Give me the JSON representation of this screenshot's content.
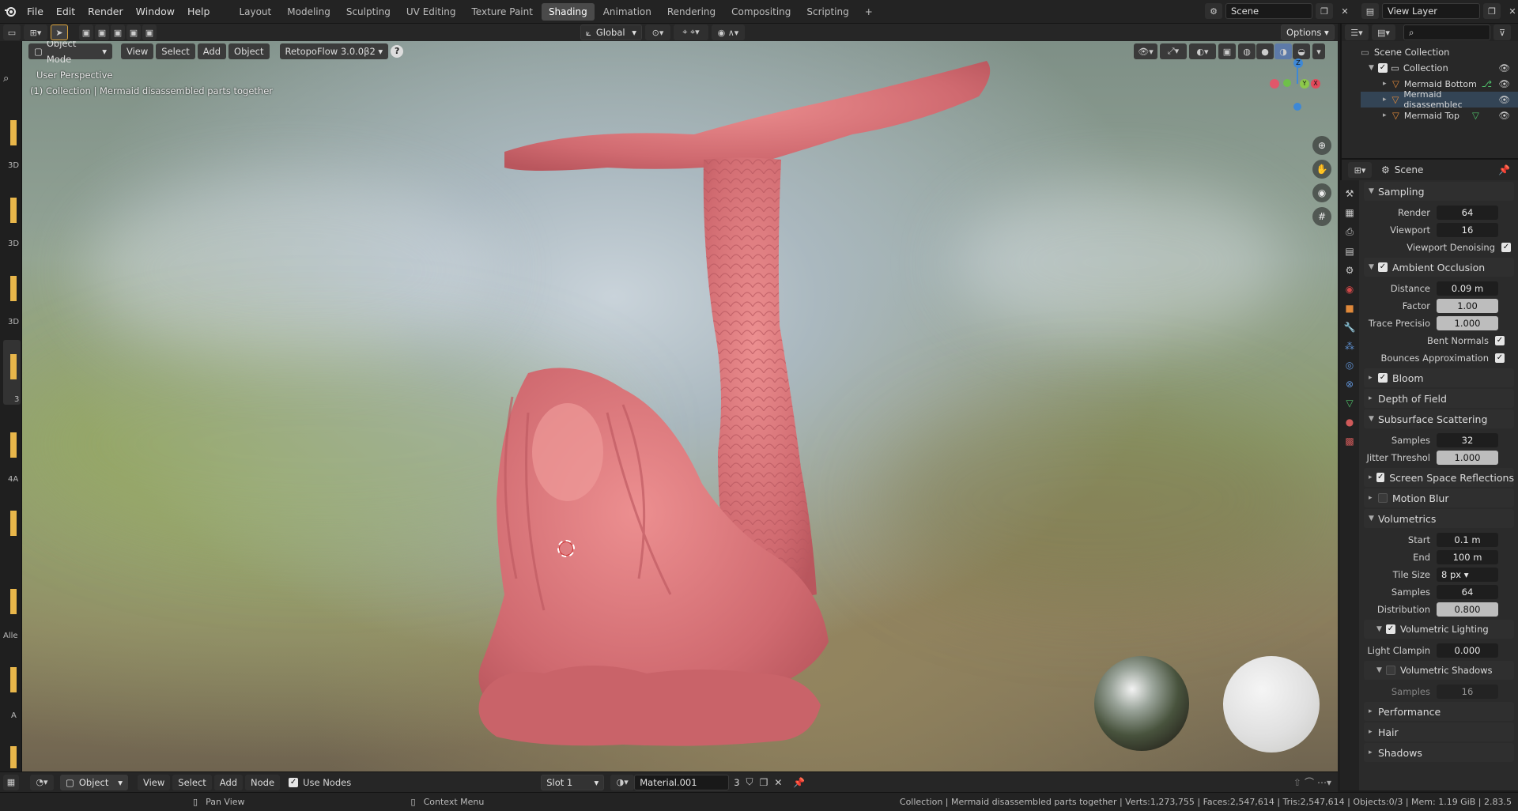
{
  "menubar": {
    "items": [
      "File",
      "Edit",
      "Render",
      "Window",
      "Help"
    ],
    "workspaces": [
      "Layout",
      "Modeling",
      "Sculpting",
      "UV Editing",
      "Texture Paint",
      "Shading",
      "Animation",
      "Rendering",
      "Compositing",
      "Scripting"
    ],
    "active_workspace": "Shading",
    "plus": "+",
    "scene": "Scene",
    "view_layer": "View Layer"
  },
  "viewport_header": {
    "mode": "Object Mode",
    "menus": [
      "View",
      "Select",
      "Add",
      "Object"
    ],
    "addon": "RetopoFlow 3.0.0β2",
    "help": "?",
    "transform": "Global",
    "options": "Options"
  },
  "viewport": {
    "perspective": "User Perspective",
    "collection_info": "(1) Collection | Mermaid disassembled parts together",
    "gizmo": {
      "z": "Z",
      "y": "Y",
      "x": "X"
    }
  },
  "left_strip": {
    "labels": [
      "3D",
      "3D",
      "3D",
      "3",
      "4A",
      "Alle",
      "A"
    ]
  },
  "outliner": {
    "root": "Scene Collection",
    "collection": "Collection",
    "items": [
      {
        "label": "Mermaid Bottom"
      },
      {
        "label": "Mermaid disassemblec"
      },
      {
        "label": "Mermaid Top"
      }
    ]
  },
  "properties": {
    "context": "Scene",
    "sampling": {
      "title": "Sampling",
      "render_label": "Render",
      "render": "64",
      "viewport_label": "Viewport",
      "viewport": "16",
      "denoise_label": "Viewport Denoising"
    },
    "ao": {
      "title": "Ambient Occlusion",
      "distance_label": "Distance",
      "distance": "0.09 m",
      "factor_label": "Factor",
      "factor": "1.00",
      "trace_label": "Trace Precisio",
      "trace": "1.000",
      "bent_label": "Bent Normals",
      "bounces_label": "Bounces Approximation"
    },
    "bloom": "Bloom",
    "dof": "Depth of Field",
    "sss": {
      "title": "Subsurface Scattering",
      "samples_label": "Samples",
      "samples": "32",
      "jitter_label": "Jitter Threshol",
      "jitter": "1.000"
    },
    "ssr": "Screen Space Reflections",
    "motion_blur": "Motion Blur",
    "volumetrics": {
      "title": "Volumetrics",
      "start_label": "Start",
      "start": "0.1 m",
      "end_label": "End",
      "end": "100 m",
      "tile_label": "Tile Size",
      "tile": "8 px",
      "samples_label": "Samples",
      "samples": "64",
      "dist_label": "Distribution",
      "distribution": "0.800",
      "lighting": "Volumetric Lighting",
      "clamp_label": "Light Clampin",
      "clamp": "0.000",
      "shadows": "Volumetric Shadows",
      "shadow_samples_label": "Samples",
      "shadow_samples": "16"
    },
    "performance": "Performance",
    "hair": "Hair",
    "shadows": "Shadows"
  },
  "shader_header": {
    "object": "Object",
    "menus": [
      "View",
      "Select",
      "Add",
      "Node"
    ],
    "use_nodes": "Use Nodes",
    "slot": "Slot 1",
    "material": "Material.001",
    "users": "3"
  },
  "statusbar": {
    "pan": "Pan View",
    "context": "Context Menu",
    "info": "Collection | Mermaid disassembled parts together | Verts:1,273,755 | Faces:2,547,614 | Tris:2,547,614 | Objects:0/3 | Mem: 1.19 GiB | 2.83.5"
  },
  "colors": {
    "accent": "#4772b3",
    "model": "#d9767a",
    "object_orange": "#e0893a",
    "mesh_green": "#4fbf6a"
  }
}
